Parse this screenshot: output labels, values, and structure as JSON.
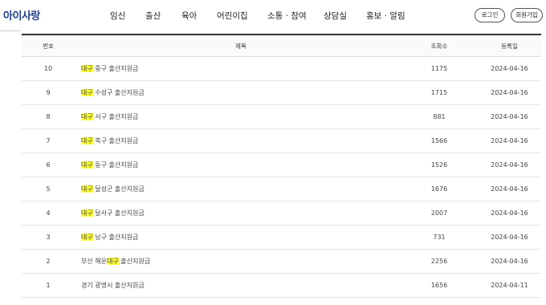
{
  "header": {
    "logo": "아이사랑",
    "nav": [
      "임신",
      "출산",
      "육아",
      "어린이집",
      "소통 · 참여",
      "상담실",
      "홍보 · 알림"
    ],
    "login_label": "로그인",
    "signup_label": "회원가입"
  },
  "table": {
    "headers": {
      "no": "번호",
      "title": "제목",
      "views": "조회수",
      "date": "등록일"
    },
    "highlight_color": "#ffff33",
    "rows": [
      {
        "no": "10",
        "pre": "",
        "hl": "대구",
        "post": " 중구 출산지원금",
        "views": "1175",
        "date": "2024-04-16"
      },
      {
        "no": "9",
        "pre": "",
        "hl": "대구",
        "post": " 수성구 출산지원금",
        "views": "1715",
        "date": "2024-04-16"
      },
      {
        "no": "8",
        "pre": "",
        "hl": "대구",
        "post": " 서구 출산지원금",
        "views": "881",
        "date": "2024-04-16"
      },
      {
        "no": "7",
        "pre": "",
        "hl": "대구",
        "post": " 북구 출산지원금",
        "views": "1566",
        "date": "2024-04-16"
      },
      {
        "no": "6",
        "pre": "",
        "hl": "대구",
        "post": " 동구 출산지원금",
        "views": "1526",
        "date": "2024-04-16"
      },
      {
        "no": "5",
        "pre": "",
        "hl": "대구",
        "post": " 달성군 출산지원금",
        "views": "1676",
        "date": "2024-04-16"
      },
      {
        "no": "4",
        "pre": "",
        "hl": "대구",
        "post": " 달서구 출산지원금",
        "views": "2007",
        "date": "2024-04-16"
      },
      {
        "no": "3",
        "pre": "",
        "hl": "대구",
        "post": " 남구 출산지원금",
        "views": "731",
        "date": "2024-04-16"
      },
      {
        "no": "2",
        "pre": "부산 해운",
        "hl": "대구",
        "post": " 출산지원금",
        "views": "2256",
        "date": "2024-04-16"
      },
      {
        "no": "1",
        "pre": "경기 광명시 출산지원금",
        "hl": "",
        "post": "",
        "views": "1656",
        "date": "2024-04-11"
      }
    ]
  }
}
